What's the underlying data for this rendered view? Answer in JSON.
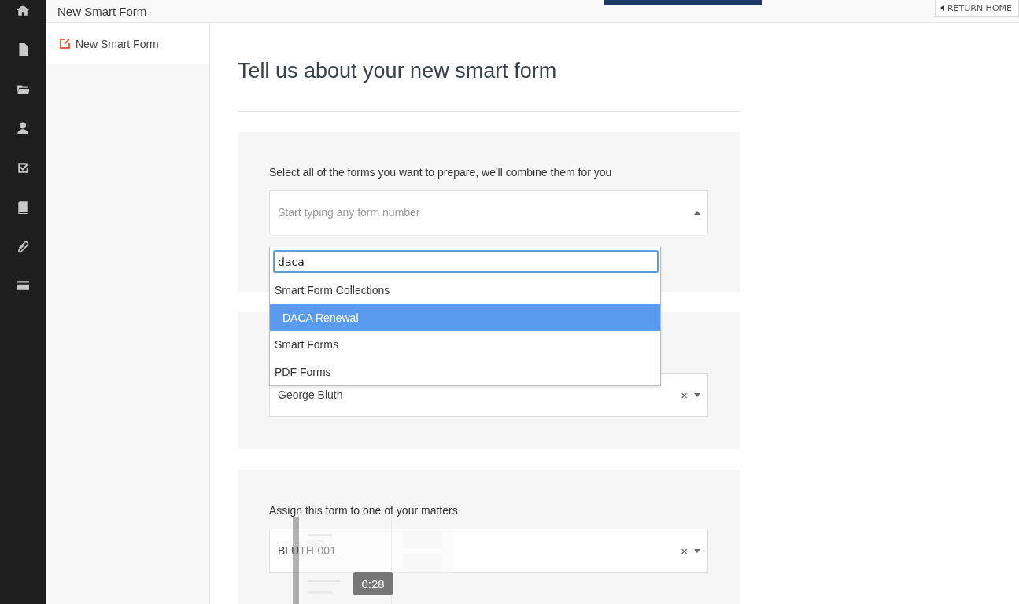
{
  "header": {
    "title": "New Smart Form",
    "return_button": "RETURN HOME"
  },
  "subnav": {
    "items": [
      {
        "label": "New Smart Form"
      }
    ]
  },
  "page": {
    "heading": "Tell us about your new smart form"
  },
  "sections": [
    {
      "label": "Select all of the forms you want to prepare, we'll combine them for you",
      "field": {
        "placeholder": "Start typing any form number",
        "open": true
      },
      "dropdown": {
        "search_value": "daca",
        "options": [
          {
            "kind": "group",
            "label": "Smart Form Collections"
          },
          {
            "kind": "option",
            "label": "DACA Renewal",
            "selected": true
          },
          {
            "kind": "group",
            "label": "Smart Forms"
          },
          {
            "kind": "group",
            "label": "PDF Forms"
          }
        ]
      }
    },
    {
      "field": {
        "value": "George Bluth",
        "open": false,
        "clear_symbol": "×"
      }
    },
    {
      "label": "Assign this form to one of your matters",
      "field": {
        "value": "BLUTH-001",
        "open": false,
        "clear_symbol": "×"
      }
    }
  ],
  "video_preview": {
    "time": "0:28"
  }
}
